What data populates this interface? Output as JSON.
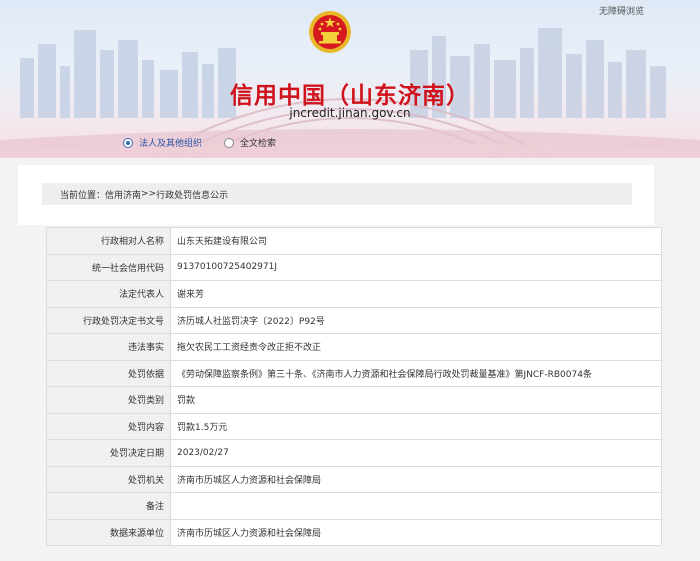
{
  "header": {
    "accessibility_link": "无障碍浏览",
    "site_title": "信用中国（山东济南）",
    "site_url": "jncredit.jinan.gov.cn",
    "emblem_icon": "national-emblem-icon",
    "search_options": [
      {
        "label": "法人及其他组织",
        "selected": true
      },
      {
        "label": "全文检索",
        "selected": false
      }
    ]
  },
  "breadcrumb": {
    "prefix": "当前位置：",
    "home": "信用济南",
    "separator": ">>",
    "current": "行政处罚信息公示"
  },
  "record": [
    {
      "label": "行政相对人名称",
      "value": "山东天拓建设有限公司"
    },
    {
      "label": "统一社会信用代码",
      "value": "91370100725402971J"
    },
    {
      "label": "法定代表人",
      "value": "谢来芳"
    },
    {
      "label": "行政处罚决定书文号",
      "value": "济历城人社监罚决字〔2022〕P92号"
    },
    {
      "label": "违法事实",
      "value": "拖欠农民工工资经责令改正拒不改正"
    },
    {
      "label": "处罚依据",
      "value": "《劳动保障监察条例》第三十条、《济南市人力资源和社会保障局行政处罚裁量基准》第JNCF-RB0074条"
    },
    {
      "label": "处罚类别",
      "value": "罚款"
    },
    {
      "label": "处罚内容",
      "value": "罚款1.5万元"
    },
    {
      "label": "处罚决定日期",
      "value": "2023/02/27"
    },
    {
      "label": "处罚机关",
      "value": "济南市历城区人力资源和社会保障局"
    },
    {
      "label": "备注",
      "value": ""
    },
    {
      "label": "数据来源单位",
      "value": "济南市历城区人力资源和社会保障局"
    }
  ],
  "colors": {
    "title_red": "#d0121b",
    "link_blue": "#2b55a7",
    "label_bg": "#f0f0f0"
  }
}
